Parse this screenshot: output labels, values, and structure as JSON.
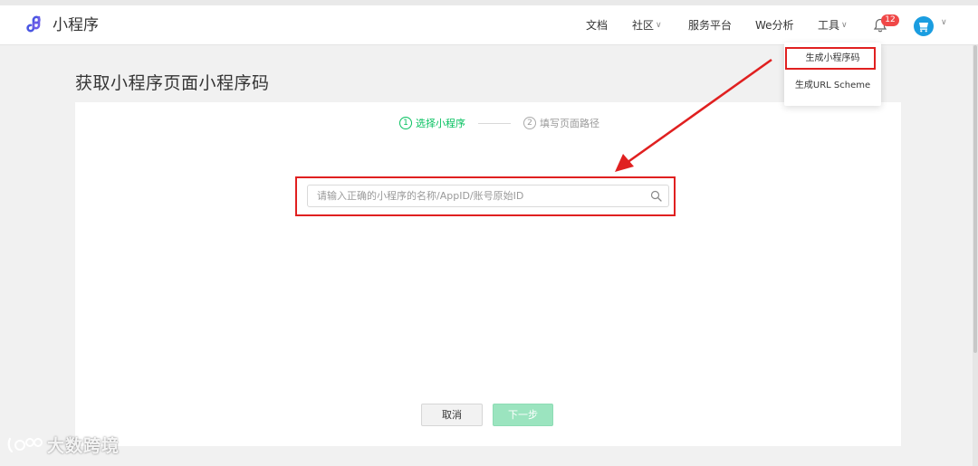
{
  "app": {
    "name": "小程序",
    "brand_color": "#4a56e2"
  },
  "nav": {
    "docs": "文档",
    "community": "社区",
    "service": "服务平台",
    "analytics": "We分析",
    "tools": "工具",
    "notification_count": "12"
  },
  "page": {
    "title": "获取小程序页面小程序码"
  },
  "steps": [
    {
      "num": "1",
      "label": "选择小程序",
      "active": true
    },
    {
      "num": "2",
      "label": "填写页面路径",
      "active": false
    }
  ],
  "search": {
    "placeholder": "请输入正确的小程序的名称/AppID/账号原始ID",
    "value": ""
  },
  "buttons": {
    "cancel": "取消",
    "next": "下一步"
  },
  "tools_menu": {
    "items": [
      "生成小程序码",
      "生成URL Scheme"
    ]
  },
  "watermark": {
    "text": "大数跨境"
  },
  "colors": {
    "accent": "#07c160",
    "highlight": "#e02020",
    "disabled_green": "#9be4bf",
    "avatar": "#1a9de0"
  }
}
